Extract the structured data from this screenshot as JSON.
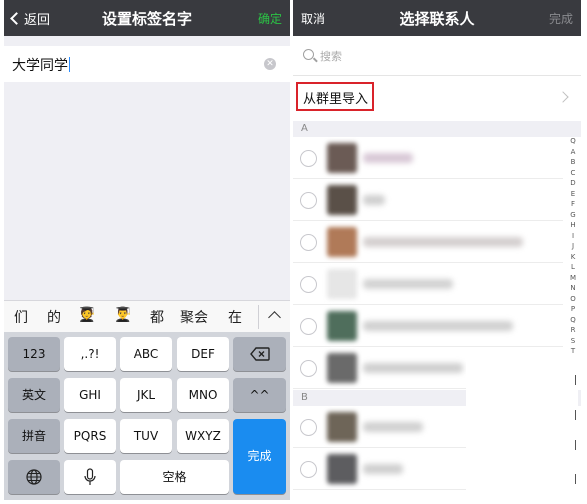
{
  "left": {
    "nav": {
      "back_label": "返回",
      "title": "设置标签名字",
      "confirm_label": "确定"
    },
    "input": {
      "value": "大学同学"
    },
    "candidates": [
      "们",
      "的",
      "🧑‍🎓",
      "👨‍🎓",
      "都",
      "聚会",
      "在"
    ],
    "keyboard": {
      "row1": [
        "123",
        ",.?!",
        "ABC",
        "DEF"
      ],
      "row2": [
        "英文",
        "GHI",
        "JKL",
        "MNO",
        "^^"
      ],
      "row3": [
        "拼音",
        "PQRS",
        "TUV",
        "WXYZ"
      ],
      "space": "空格",
      "done": "完成"
    }
  },
  "right": {
    "nav": {
      "cancel_label": "取消",
      "title": "选择联系人",
      "done_label": "完成"
    },
    "search": {
      "placeholder": "搜索"
    },
    "import_label": "从群里导入",
    "sections": [
      "A",
      "B"
    ],
    "index": [
      "Q",
      "A",
      "B",
      "C",
      "D",
      "E",
      "F",
      "G",
      "H",
      "I",
      "J",
      "K",
      "L",
      "M",
      "N",
      "O",
      "P",
      "Q",
      "R",
      "S",
      "T"
    ]
  },
  "colors": {
    "navbar": "#393a3f",
    "accent_green": "#2bc245",
    "highlight_red": "#d9232a",
    "keyboard_blue": "#1a8cf0"
  }
}
